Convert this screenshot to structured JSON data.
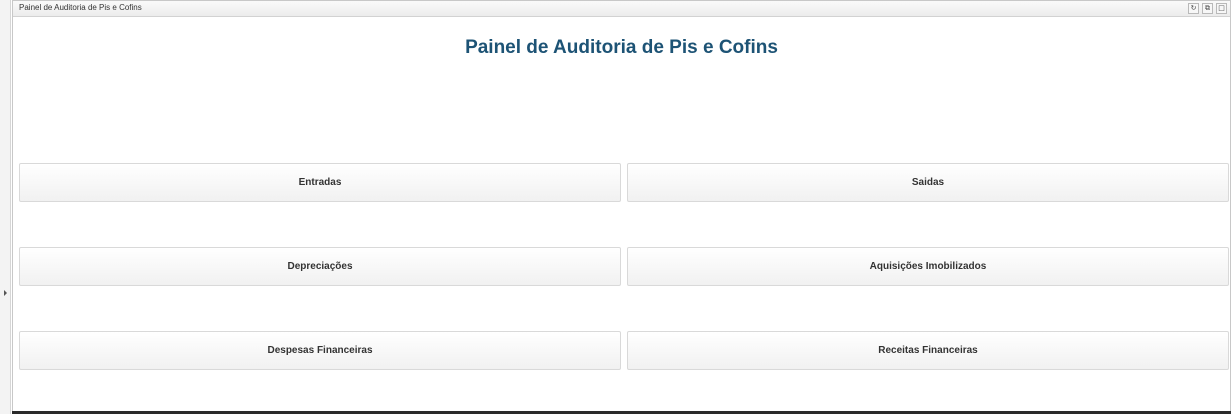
{
  "window": {
    "title": "Painel de Auditoria de Pis e Cofins",
    "controls": [
      {
        "icon": "refresh-icon",
        "glyph": "↻"
      },
      {
        "icon": "restore-icon",
        "glyph": "⧉"
      },
      {
        "icon": "maximize-icon",
        "glyph": "□"
      }
    ]
  },
  "main": {
    "heading": "Painel de Auditoria de Pis e Cofins",
    "buttons": {
      "entradas": "Entradas",
      "saidas": "Saidas",
      "depreciacoes": "Depreciações",
      "aquisicoes": "Aquisições Imobilizados",
      "despesas": "Despesas Financeiras",
      "receitas": "Receitas Financeiras"
    }
  },
  "colors": {
    "heading": "#1d5375",
    "tile_border": "#d9d9d9"
  }
}
